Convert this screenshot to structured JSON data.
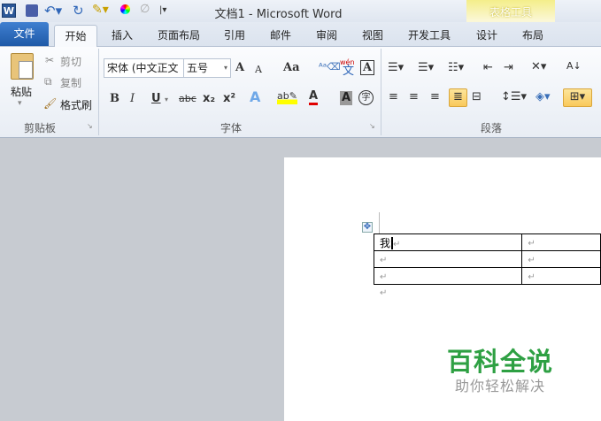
{
  "window": {
    "title": "文档1 - Microsoft Word",
    "context_tab_group": "表格工具"
  },
  "quick_access": {
    "icons": [
      "word-logo-icon",
      "save-icon",
      "undo-icon",
      "redo-icon",
      "format-icon",
      "color-icon",
      "draw-icon",
      "customize-icon"
    ]
  },
  "tabs": [
    {
      "label": "文件"
    },
    {
      "label": "开始",
      "active": true
    },
    {
      "label": "插入"
    },
    {
      "label": "页面布局"
    },
    {
      "label": "引用"
    },
    {
      "label": "邮件"
    },
    {
      "label": "审阅"
    },
    {
      "label": "视图"
    },
    {
      "label": "开发工具"
    },
    {
      "label": "设计"
    },
    {
      "label": "布局"
    }
  ],
  "clipboard": {
    "paste": "粘贴",
    "cut": "剪切",
    "copy": "复制",
    "format_painter": "格式刷",
    "group": "剪贴板"
  },
  "font": {
    "name": "宋体 (中文正文",
    "size": "五号",
    "group": "字体",
    "bold": "B",
    "italic": "I",
    "underline": "U",
    "strike": "abc",
    "sub": "x₂",
    "sup": "x²",
    "case": "Aa",
    "grow": "A",
    "shrink": "A",
    "char_border": "A",
    "char_shade": "A",
    "enclose": "字",
    "pinyin": "wén",
    "pinyin_char": "文",
    "color_a": "A"
  },
  "paragraph": {
    "group": "段落"
  },
  "colors": {
    "accent": "#1f5aa8",
    "highlight": "#f9c95b",
    "font_color": "#e00000",
    "watermark": "#2ea043"
  },
  "document": {
    "table": [
      [
        "我",
        ""
      ],
      [
        "",
        ""
      ],
      [
        "",
        ""
      ]
    ],
    "para_mark": "↵"
  },
  "watermark": {
    "title": "百科全说",
    "subtitle": "助你轻松解决"
  }
}
